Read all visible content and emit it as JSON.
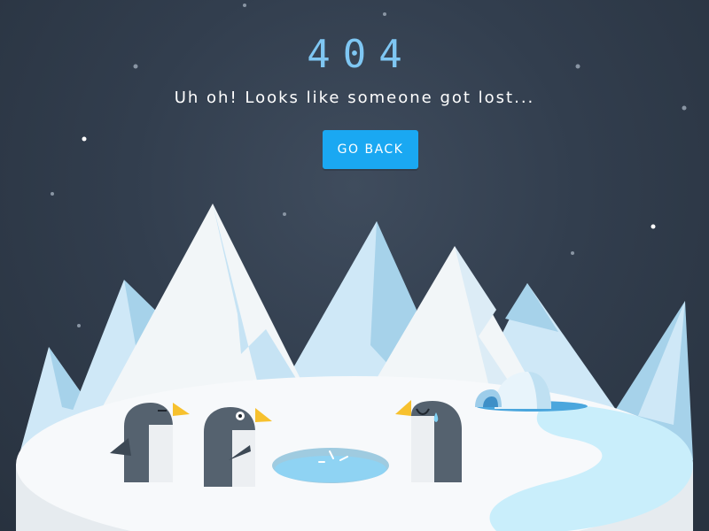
{
  "error": {
    "code": "404",
    "message": "Uh oh! Looks like someone got lost...",
    "button_label": "GO BACK"
  },
  "colors": {
    "background": "#323e4e",
    "code_text": "#7fc7f3",
    "button": "#1aa8f2",
    "snow": "#f2f6f8",
    "ice_light": "#cfe8f7",
    "ice_mid": "#a6d2ea",
    "penguin_body": "#55626f",
    "beak": "#f7c12e",
    "water": "#8fd3f3"
  },
  "icons": [
    "star-icon",
    "mountain-icon",
    "penguin-icon",
    "igloo-icon",
    "ice-hole-icon"
  ]
}
